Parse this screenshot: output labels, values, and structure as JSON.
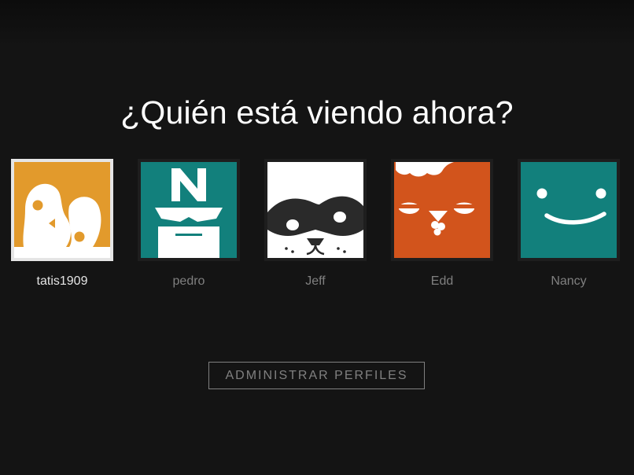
{
  "title": "¿Quién está viendo ahora?",
  "profiles": [
    {
      "name": "tatis1909",
      "avatar_icon": "penguin-face-icon",
      "color": "#e29a2c",
      "selected": true
    },
    {
      "name": "pedro",
      "avatar_icon": "masked-hero-icon",
      "color": "#12807c",
      "selected": false
    },
    {
      "name": "Jeff",
      "avatar_icon": "bandit-dog-icon",
      "color": "#ffffff",
      "selected": false
    },
    {
      "name": "Edd",
      "avatar_icon": "chicken-face-icon",
      "color": "#d2541c",
      "selected": false
    },
    {
      "name": "Nancy",
      "avatar_icon": "smiley-face-icon",
      "color": "#12807c",
      "selected": false
    }
  ],
  "manage_button": {
    "label": "ADMINISTRAR PERFILES"
  }
}
